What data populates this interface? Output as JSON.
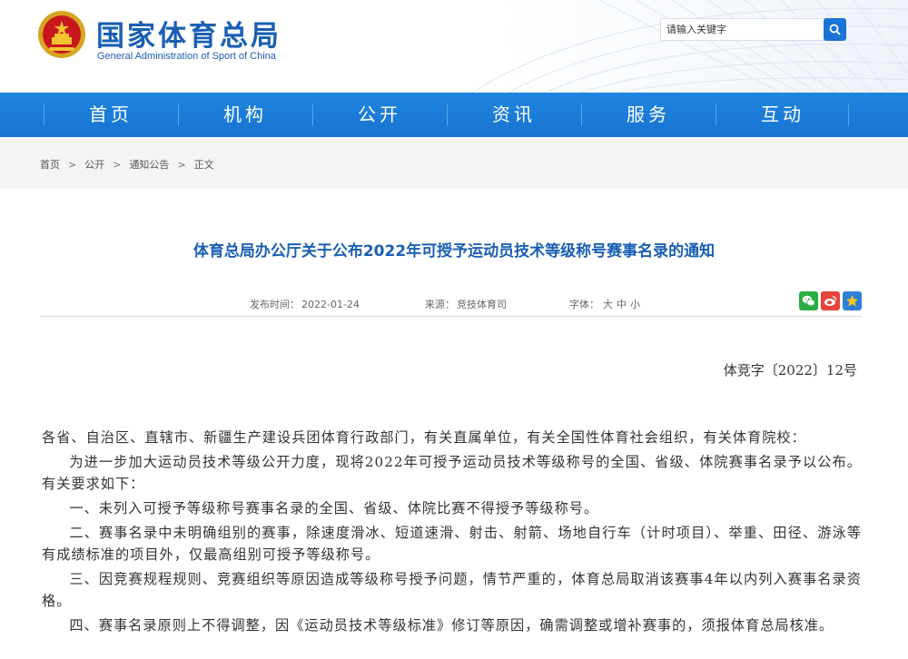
{
  "header": {
    "title": "国家体育总局",
    "subtitle": "General Administration of Sport of China",
    "search_placeholder": "请输入关键字"
  },
  "nav": {
    "items": [
      {
        "label": "首页"
      },
      {
        "label": "机构"
      },
      {
        "label": "公开"
      },
      {
        "label": "资讯"
      },
      {
        "label": "服务"
      },
      {
        "label": "互动"
      }
    ]
  },
  "breadcrumb": {
    "items": [
      "首页",
      "公开",
      "通知公告",
      "正文"
    ],
    "separator": ">"
  },
  "article": {
    "title": "体育总局办公厅关于公布2022年可授予运动员技术等级称号赛事名录的通知",
    "publish_label": "发布时间：",
    "publish_date": "2022-01-24",
    "source_label": "来源：",
    "source": "竞技体育司",
    "fontsize_label": "字体：",
    "fontsize_options": [
      "大",
      "中",
      "小"
    ],
    "doc_number": "体竞字〔2022〕12号",
    "paragraphs": [
      "各省、自治区、直辖市、新疆生产建设兵团体育行政部门，有关直属单位，有关全国性体育社会组织，有关体育院校：",
      "为进一步加大运动员技术等级公开力度，现将2022年可授予运动员技术等级称号的全国、省级、体院赛事名录予以公布。有关要求如下：",
      "一、未列入可授予等级称号赛事名录的全国、省级、体院比赛不得授予等级称号。",
      "二、赛事名录中未明确组别的赛事，除速度滑冰、短道速滑、射击、射箭、场地自行车（计时项目）、举重、田径、游泳等有成绩标准的项目外，仅最高组别可授予等级称号。",
      "三、因竞赛规程规则、竞赛组织等原因造成等级称号授予问题，情节严重的，体育总局取消该赛事4年以内列入赛事名录资格。",
      "四、赛事名录原则上不得调整，因《运动员技术等级标准》修订等原因，确需调整或增补赛事的，须报体育总局核准。"
    ]
  },
  "share": {
    "icons": [
      "wechat-icon",
      "weibo-icon",
      "favorite-star-icon"
    ],
    "colors": {
      "wechat": "#2aae43",
      "weibo": "#e6453c",
      "star": "#2f7fd6"
    }
  },
  "colors": {
    "brand_blue": "#1a5fb4",
    "nav_blue": "#1a7bd8"
  }
}
